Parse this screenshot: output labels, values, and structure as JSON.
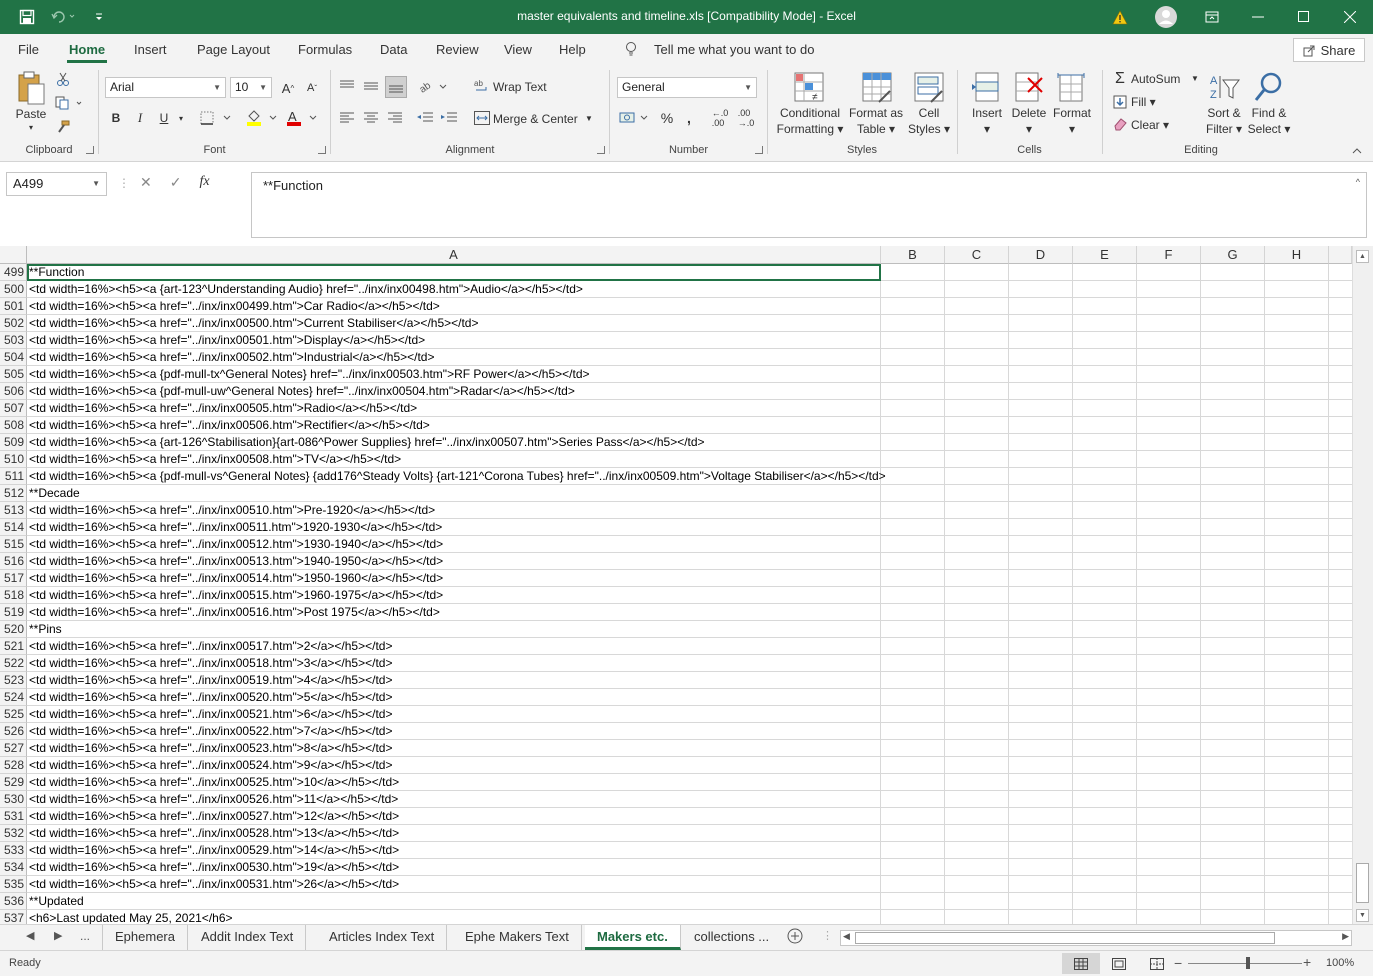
{
  "window": {
    "title": "master equivalents and timeline.xls  [Compatibility Mode]  -  Excel"
  },
  "ribbon_tabs": [
    "File",
    "Home",
    "Insert",
    "Page Layout",
    "Formulas",
    "Data",
    "Review",
    "View",
    "Help"
  ],
  "active_tab": "Home",
  "tell_me": "Tell me what you want to do",
  "share_label": "Share",
  "ribbon": {
    "clipboard": {
      "label": "Clipboard",
      "paste": "Paste"
    },
    "font": {
      "label": "Font",
      "name": "Arial",
      "size": "10",
      "bold": "B",
      "italic": "I",
      "underline": "U"
    },
    "alignment": {
      "label": "Alignment",
      "wrap": "Wrap Text",
      "merge": "Merge & Center"
    },
    "number": {
      "label": "Number",
      "format": "General"
    },
    "styles": {
      "label": "Styles",
      "conditional": "Conditional",
      "conditional2": "Formatting",
      "format_table": "Format as",
      "format_table2": "Table",
      "cell_styles": "Cell",
      "cell_styles2": "Styles"
    },
    "cells": {
      "label": "Cells",
      "insert": "Insert",
      "delete": "Delete",
      "format": "Format"
    },
    "editing": {
      "label": "Editing",
      "autosum": "AutoSum",
      "fill": "Fill",
      "clear": "Clear",
      "sort": "Sort &",
      "sort2": "Filter",
      "find": "Find &",
      "find2": "Select"
    }
  },
  "formula_bar": {
    "name_box": "A499",
    "formula": "**Function"
  },
  "columns": [
    "A",
    "B",
    "C",
    "D",
    "E",
    "F",
    "G",
    "H"
  ],
  "rows": [
    {
      "n": "499",
      "a": "**Function"
    },
    {
      "n": "500",
      "a": "<td width=16%><h5><a {art-123^Understanding Audio} href=\"../inx/inx00498.htm\">Audio</a></h5></td>"
    },
    {
      "n": "501",
      "a": "<td width=16%><h5><a href=\"../inx/inx00499.htm\">Car Radio</a></h5></td>"
    },
    {
      "n": "502",
      "a": "<td width=16%><h5><a href=\"../inx/inx00500.htm\">Current Stabiliser</a></h5></td>"
    },
    {
      "n": "503",
      "a": "<td width=16%><h5><a href=\"../inx/inx00501.htm\">Display</a></h5></td>"
    },
    {
      "n": "504",
      "a": "<td width=16%><h5><a href=\"../inx/inx00502.htm\">Industrial</a></h5></td>"
    },
    {
      "n": "505",
      "a": "<td width=16%><h5><a {pdf-mull-tx^General Notes} href=\"../inx/inx00503.htm\">RF Power</a></h5></td>"
    },
    {
      "n": "506",
      "a": "<td width=16%><h5><a {pdf-mull-uw^General Notes} href=\"../inx/inx00504.htm\">Radar</a></h5></td>"
    },
    {
      "n": "507",
      "a": "<td width=16%><h5><a href=\"../inx/inx00505.htm\">Radio</a></h5></td>"
    },
    {
      "n": "508",
      "a": "<td width=16%><h5><a href=\"../inx/inx00506.htm\">Rectifier</a></h5></td>"
    },
    {
      "n": "509",
      "a": "<td width=16%><h5><a {art-126^Stabilisation}{art-086^Power Supplies} href=\"../inx/inx00507.htm\">Series Pass</a></h5></td>"
    },
    {
      "n": "510",
      "a": "<td width=16%><h5><a href=\"../inx/inx00508.htm\">TV</a></h5></td>"
    },
    {
      "n": "511",
      "a": "<td width=16%><h5><a {pdf-mull-vs^General Notes} {add176^Steady Volts} {art-121^Corona Tubes} href=\"../inx/inx00509.htm\">Voltage Stabiliser</a></h5></td>"
    },
    {
      "n": "512",
      "a": "**Decade"
    },
    {
      "n": "513",
      "a": "<td width=16%><h5><a href=\"../inx/inx00510.htm\">Pre-1920</a></h5></td>"
    },
    {
      "n": "514",
      "a": "<td width=16%><h5><a href=\"../inx/inx00511.htm\">1920-1930</a></h5></td>"
    },
    {
      "n": "515",
      "a": "<td width=16%><h5><a href=\"../inx/inx00512.htm\">1930-1940</a></h5></td>"
    },
    {
      "n": "516",
      "a": "<td width=16%><h5><a href=\"../inx/inx00513.htm\">1940-1950</a></h5></td>"
    },
    {
      "n": "517",
      "a": "<td width=16%><h5><a href=\"../inx/inx00514.htm\">1950-1960</a></h5></td>"
    },
    {
      "n": "518",
      "a": "<td width=16%><h5><a href=\"../inx/inx00515.htm\">1960-1975</a></h5></td>"
    },
    {
      "n": "519",
      "a": "<td width=16%><h5><a href=\"../inx/inx00516.htm\">Post 1975</a></h5></td>"
    },
    {
      "n": "520",
      "a": "**Pins"
    },
    {
      "n": "521",
      "a": "<td width=16%><h5><a href=\"../inx/inx00517.htm\">2</a></h5></td>"
    },
    {
      "n": "522",
      "a": "<td width=16%><h5><a href=\"../inx/inx00518.htm\">3</a></h5></td>"
    },
    {
      "n": "523",
      "a": "<td width=16%><h5><a href=\"../inx/inx00519.htm\">4</a></h5></td>"
    },
    {
      "n": "524",
      "a": "<td width=16%><h5><a href=\"../inx/inx00520.htm\">5</a></h5></td>"
    },
    {
      "n": "525",
      "a": "<td width=16%><h5><a href=\"../inx/inx00521.htm\">6</a></h5></td>"
    },
    {
      "n": "526",
      "a": "<td width=16%><h5><a href=\"../inx/inx00522.htm\">7</a></h5></td>"
    },
    {
      "n": "527",
      "a": "<td width=16%><h5><a href=\"../inx/inx00523.htm\">8</a></h5></td>"
    },
    {
      "n": "528",
      "a": "<td width=16%><h5><a href=\"../inx/inx00524.htm\">9</a></h5></td>"
    },
    {
      "n": "529",
      "a": "<td width=16%><h5><a href=\"../inx/inx00525.htm\">10</a></h5></td>"
    },
    {
      "n": "530",
      "a": "<td width=16%><h5><a href=\"../inx/inx00526.htm\">11</a></h5></td>"
    },
    {
      "n": "531",
      "a": "<td width=16%><h5><a href=\"../inx/inx00527.htm\">12</a></h5></td>"
    },
    {
      "n": "532",
      "a": "<td width=16%><h5><a href=\"../inx/inx00528.htm\">13</a></h5></td>"
    },
    {
      "n": "533",
      "a": "<td width=16%><h5><a href=\"../inx/inx00529.htm\">14</a></h5></td>"
    },
    {
      "n": "534",
      "a": "<td width=16%><h5><a href=\"../inx/inx00530.htm\">19</a></h5></td>"
    },
    {
      "n": "535",
      "a": "<td width=16%><h5><a href=\"../inx/inx00531.htm\">26</a></h5></td>"
    },
    {
      "n": "536",
      "a": "**Updated"
    },
    {
      "n": "537",
      "a": "<h6>Last updated May 25, 2021</h6>"
    }
  ],
  "sheet_tabs": [
    "Ephemera",
    "Addit Index Text",
    "Articles Index Text",
    "Ephe Makers Text",
    "Makers etc.",
    "collections ..."
  ],
  "active_sheet": "Makers etc.",
  "sheet_nav_more": "...",
  "status": {
    "ready": "Ready",
    "zoom": "100%"
  },
  "colors": {
    "accent": "#217346",
    "ribbon_bg": "#f3f3f3"
  }
}
